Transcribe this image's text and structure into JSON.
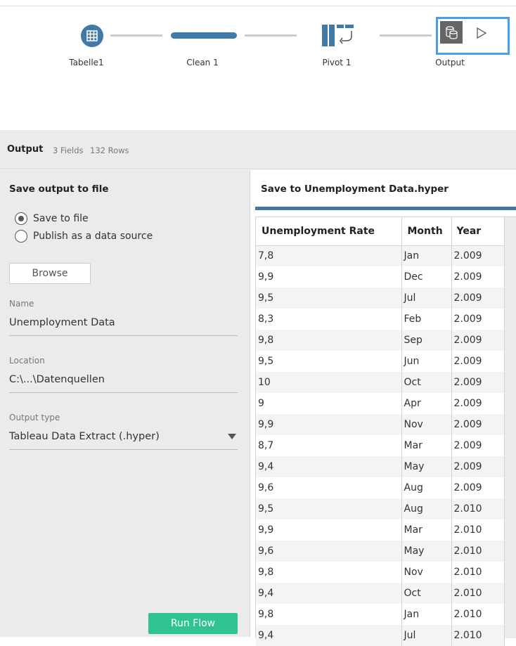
{
  "flow": {
    "nodes": [
      {
        "label": "Tabelle1",
        "icon": "table-icon"
      },
      {
        "label": "Clean 1",
        "icon": "clean-step-bar"
      },
      {
        "label": "Pivot 1",
        "icon": "pivot-icon"
      },
      {
        "label": "Output",
        "icon": "output-icon"
      }
    ],
    "accent": "#417aa6",
    "selected": "Output"
  },
  "header": {
    "title": "Output",
    "fields": "3 Fields",
    "rows": "132 Rows"
  },
  "left": {
    "title": "Save output to file",
    "options": [
      {
        "label": "Save to file",
        "checked": true
      },
      {
        "label": "Publish as a data source",
        "checked": false
      }
    ],
    "browse": "Browse",
    "name_label": "Name",
    "name_value": "Unemployment Data",
    "location_label": "Location",
    "location_value": "C:\\...\\Datenquellen",
    "type_label": "Output type",
    "type_value": "Tableau Data Extract (.hyper)",
    "run": "Run Flow",
    "run_color": "#30c391"
  },
  "right": {
    "title": "Save to Unemployment Data.hyper",
    "columns": [
      "Unemployment Rate",
      "Month",
      "Year"
    ],
    "rows": [
      [
        "7,8",
        "Jan",
        "2.009"
      ],
      [
        "9,9",
        "Dec",
        "2.009"
      ],
      [
        "9,5",
        "Jul",
        "2.009"
      ],
      [
        "8,3",
        "Feb",
        "2.009"
      ],
      [
        "9,8",
        "Sep",
        "2.009"
      ],
      [
        "9,5",
        "Jun",
        "2.009"
      ],
      [
        "10",
        "Oct",
        "2.009"
      ],
      [
        "9",
        "Apr",
        "2.009"
      ],
      [
        "9,9",
        "Nov",
        "2.009"
      ],
      [
        "8,7",
        "Mar",
        "2.009"
      ],
      [
        "9,4",
        "May",
        "2.009"
      ],
      [
        "9,6",
        "Aug",
        "2.009"
      ],
      [
        "9,5",
        "Aug",
        "2.010"
      ],
      [
        "9,9",
        "Mar",
        "2.010"
      ],
      [
        "9,6",
        "May",
        "2.010"
      ],
      [
        "9,8",
        "Nov",
        "2.010"
      ],
      [
        "9,4",
        "Oct",
        "2.010"
      ],
      [
        "9,8",
        "Jan",
        "2.010"
      ],
      [
        "9,4",
        "Jul",
        "2.010"
      ]
    ]
  }
}
